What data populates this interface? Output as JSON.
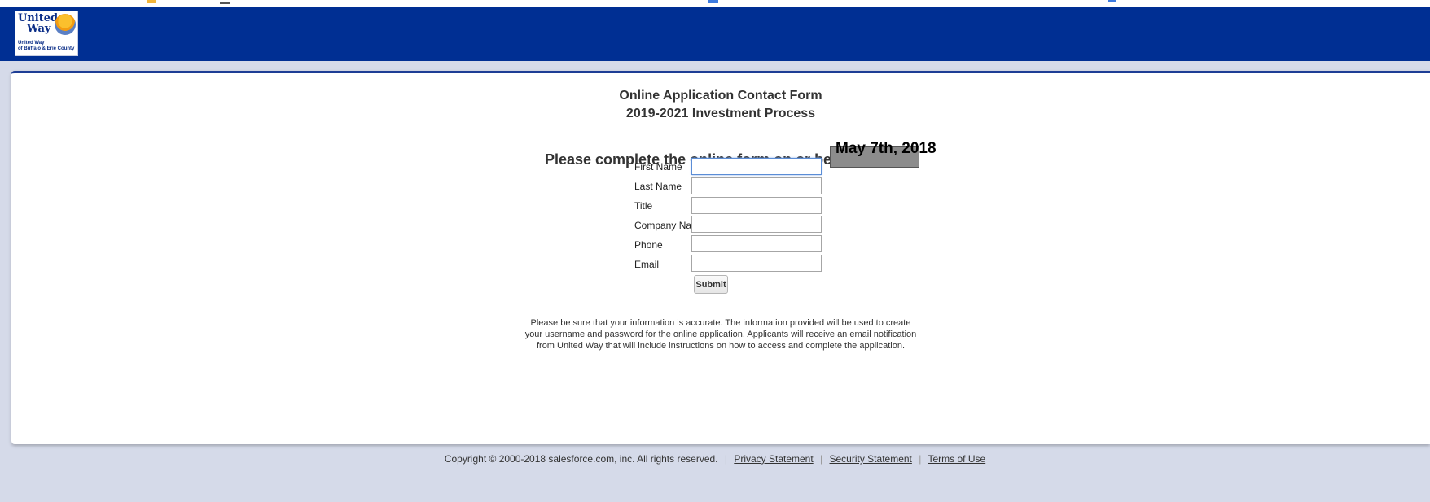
{
  "brand": {
    "logo_line1": "United",
    "logo_line2": "Way",
    "logo_tag1": "United Way",
    "logo_tag2": "of Buffalo & Erie County",
    "header_color": "#002f93",
    "accent_border": "#1d3d95"
  },
  "form_title": {
    "line1": "Online Application Contact Form",
    "line2": "2019-2021 Investment Process"
  },
  "deadline": {
    "text": "Please complete the online form on or before",
    "date": "May 7th, 2018"
  },
  "fields": [
    {
      "label": "First Name",
      "value": "",
      "focused": true
    },
    {
      "label": "Last Name",
      "value": ""
    },
    {
      "label": "Title",
      "value": ""
    },
    {
      "label": "Company Name",
      "value": ""
    },
    {
      "label": "Phone",
      "value": ""
    },
    {
      "label": "Email",
      "value": ""
    }
  ],
  "submit_label": "Submit",
  "info": {
    "line1": "Please be sure that your information is accurate. The information provided will be used to create",
    "line2": "your username and password for the online application. Applicants will receive an email notification",
    "line3": "from United Way that will include instructions on how to access and complete the application."
  },
  "footer": {
    "copyright": "Copyright © 2000-2018 salesforce.com, inc. All rights reserved.",
    "privacy": "Privacy Statement",
    "security": "Security Statement",
    "terms": "Terms of Use"
  }
}
